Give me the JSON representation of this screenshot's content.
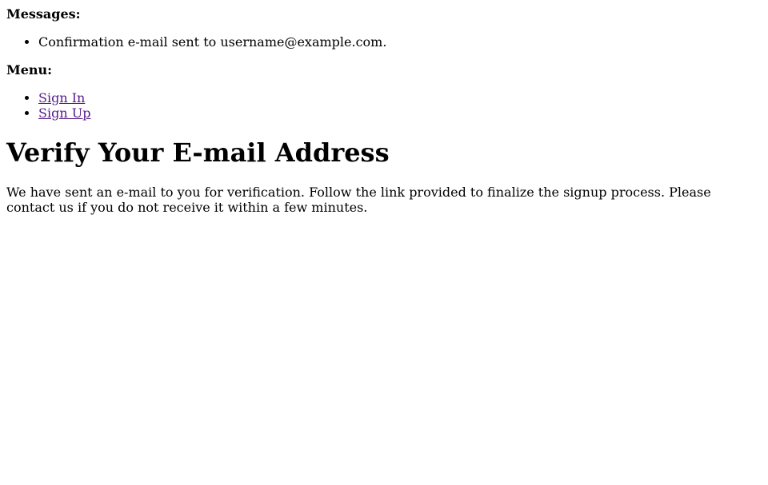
{
  "messages": {
    "label": "Messages:",
    "items": [
      "Confirmation e-mail sent to username@example.com."
    ]
  },
  "menu": {
    "label": "Menu:",
    "items": [
      {
        "label": "Sign In"
      },
      {
        "label": "Sign Up"
      }
    ]
  },
  "main": {
    "heading": "Verify Your E-mail Address",
    "body": "We have sent an e-mail to you for verification. Follow the link provided to finalize the signup process. Please contact us if you do not receive it within a few minutes."
  }
}
